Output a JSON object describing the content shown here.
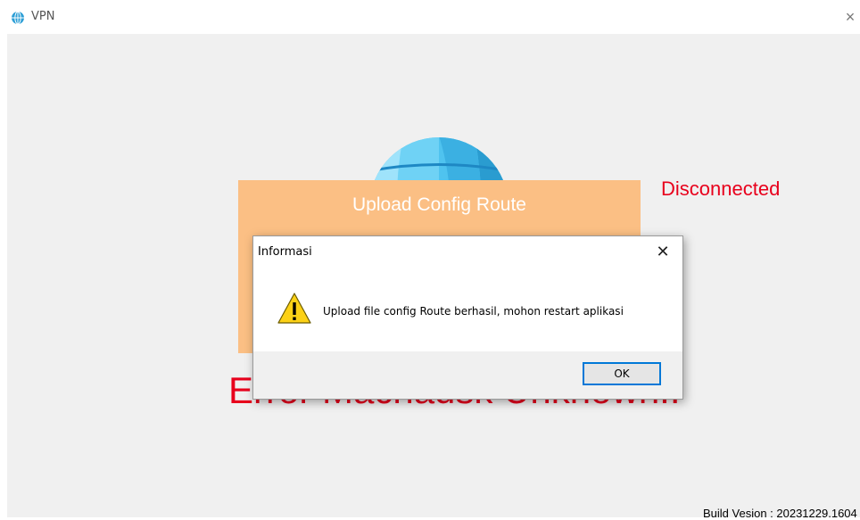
{
  "window": {
    "title": "VPN",
    "close_glyph": "×",
    "icon": "globe-icon"
  },
  "main": {
    "upload_button_label": "Upload Config Route",
    "status_text": "Disconnected",
    "status_color": "#e8001c",
    "error_text": "Error Macnadsk Unknown..",
    "build_version": "Build Vesion : 20231229.1604",
    "panel_color": "#fbbf84"
  },
  "dialog": {
    "title": "Informasi",
    "close_glyph": "✕",
    "icon": "warning-icon",
    "message": "Upload file config Route berhasil, mohon restart aplikasi",
    "ok_label": "OK",
    "accent_color": "#0078d7"
  }
}
